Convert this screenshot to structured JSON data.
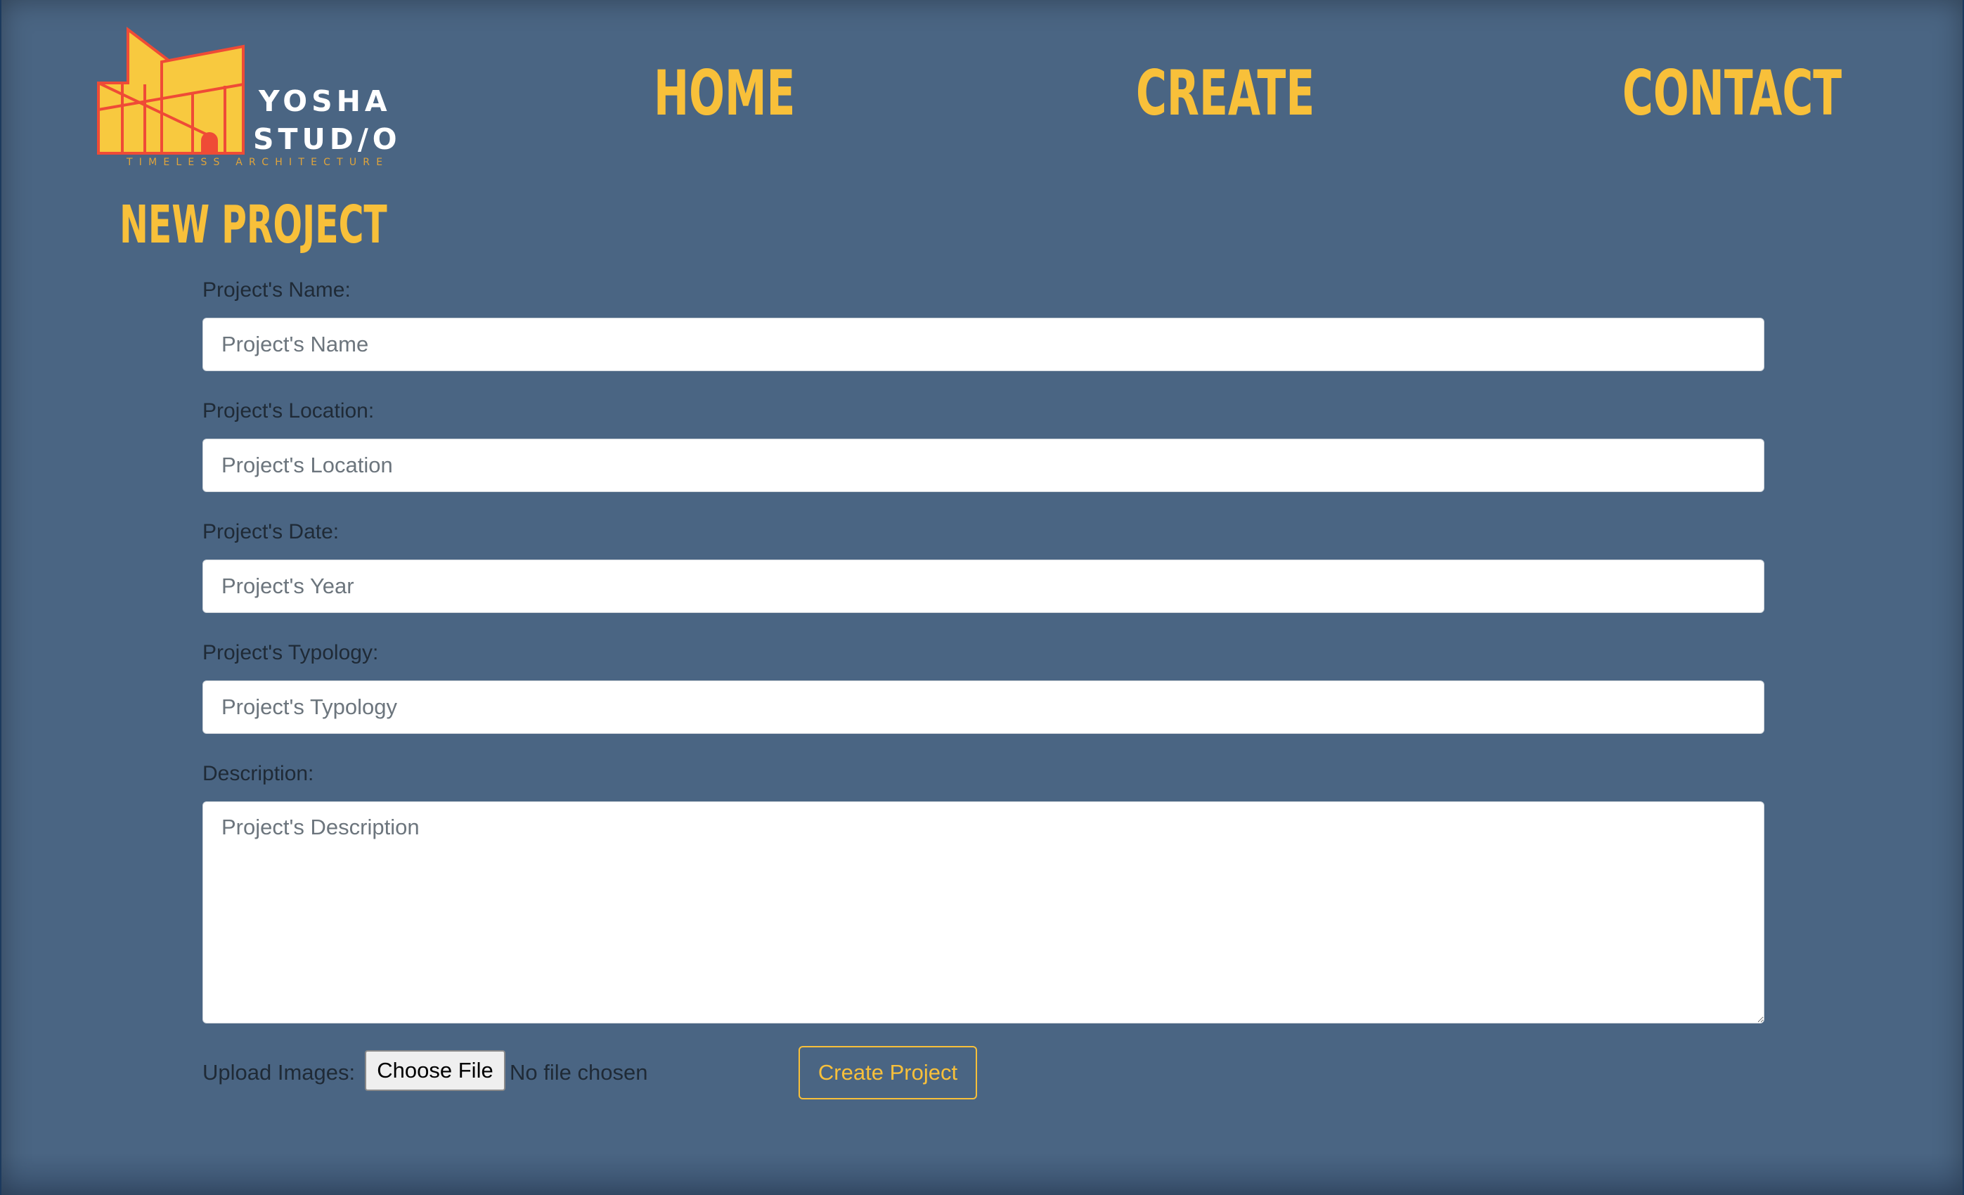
{
  "brand": {
    "name_line1": "YOSHA",
    "name_line2": "STUD/O",
    "tagline": "TIMELESS ARCHITECTURE",
    "colors": {
      "logo_fill": "#f8c93f",
      "logo_stroke": "#ef4b36",
      "tagline": "#e0a43a"
    }
  },
  "nav": {
    "items": [
      {
        "label": "HOME"
      },
      {
        "label": "CREATE"
      },
      {
        "label": "CONTACT"
      }
    ]
  },
  "page": {
    "title": "NEW PROJECT"
  },
  "form": {
    "fields": [
      {
        "label": "Project's Name:",
        "placeholder": "Project's Name",
        "value": ""
      },
      {
        "label": "Project's Location:",
        "placeholder": "Project's Location",
        "value": ""
      },
      {
        "label": "Project's Date:",
        "placeholder": "Project's Year",
        "value": ""
      },
      {
        "label": "Project's Typology:",
        "placeholder": "Project's Typology",
        "value": ""
      }
    ],
    "description": {
      "label": "Description:",
      "placeholder": "Project's Description",
      "value": ""
    },
    "upload": {
      "label": "Upload Images:",
      "button_label": "Choose File",
      "status": "No file chosen"
    },
    "submit_label": "Create Project"
  },
  "theme": {
    "background": "#4a6583",
    "accent": "#f8c03a",
    "label_text": "#1f2a36"
  }
}
